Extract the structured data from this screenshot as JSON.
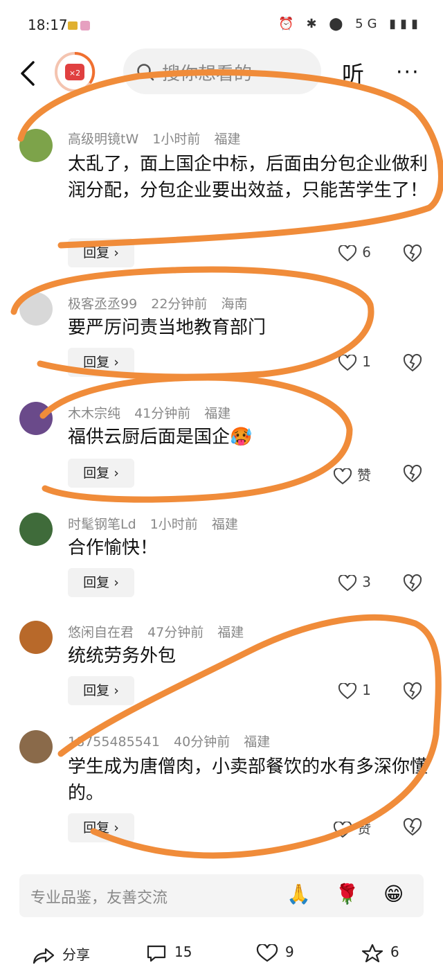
{
  "status": {
    "time": "18:17",
    "icons": "⏰ ✱ ⬤ 5G ▮▮▮"
  },
  "top": {
    "search_placeholder": "搜你想看的",
    "listen": "听",
    "badge": "×2"
  },
  "comments": [
    {
      "user": "高级明镜tW",
      "time": "1小时前",
      "region": "福建",
      "text": "太乱了，面上国企中标，后面由分包企业做利润分配，分包企业要出效益，只能苦学生了！",
      "reply": "回复 ›",
      "likes": "6"
    },
    {
      "user": "极客丞丞99",
      "time": "22分钟前",
      "region": "海南",
      "text": "要严厉问责当地教育部门",
      "reply": "回复 ›",
      "likes": "1"
    },
    {
      "user": "木木宗纯",
      "time": "41分钟前",
      "region": "福建",
      "text": "福供云厨后面是国企🥵",
      "reply": "回复 ›",
      "likes": "赞"
    },
    {
      "user": "时髦钢笔Ld",
      "time": "1小时前",
      "region": "福建",
      "text": "合作愉快！",
      "reply": "回复 ›",
      "likes": "3"
    },
    {
      "user": "悠闲自在君",
      "time": "47分钟前",
      "region": "福建",
      "text": "统统劳务外包",
      "reply": "回复 ›",
      "likes": "1"
    },
    {
      "user": "18755485541",
      "time": "40分钟前",
      "region": "福建",
      "text": "学生成为唐僧肉，小卖部餐饮的水有多深你懂的。",
      "reply": "回复 ›",
      "likes": "赞"
    }
  ],
  "input": {
    "placeholder": "专业品鉴，友善交流",
    "emoji1": "🙏",
    "emoji2": "🌹",
    "emoji3": "😁"
  },
  "bottom": {
    "share": "分享",
    "comments": "15",
    "likes": "9",
    "favorites": "6"
  },
  "colors": {
    "accent_overlay": "#f08c3a",
    "avatar1": "#7da34a",
    "avatar2": "#d8d8d8",
    "avatar3": "#6a4a8a",
    "avatar4": "#3f6b3a",
    "avatar5": "#b8692a",
    "avatar6": "#8a6a4a"
  }
}
